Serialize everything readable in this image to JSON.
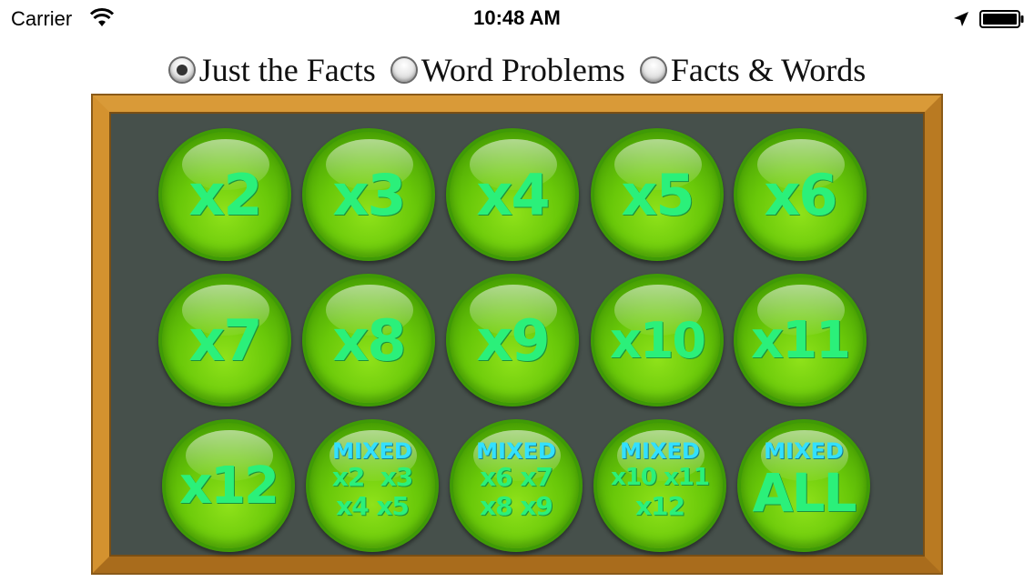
{
  "status_bar": {
    "carrier": "Carrier",
    "time": "10:48 AM",
    "icons": [
      "wifi-icon",
      "location-arrow-icon",
      "battery-icon"
    ]
  },
  "modes": [
    {
      "label": "Just the Facts",
      "selected": true
    },
    {
      "label": "Word Problems",
      "selected": false
    },
    {
      "label": "Facts & Words",
      "selected": false
    }
  ],
  "buttons": {
    "x2": "x2",
    "x3": "x3",
    "x4": "x4",
    "x5": "x5",
    "x6": "x6",
    "x7": "x7",
    "x8": "x8",
    "x9": "x9",
    "x10": "x10",
    "x11": "x11",
    "x12": "x12",
    "mixed_a": {
      "title": "MIXED",
      "line1": "x2  x3",
      "line2": "x4 x5"
    },
    "mixed_b": {
      "title": "MIXED",
      "line1": "x6 x7",
      "line2": "x8 x9"
    },
    "mixed_c": {
      "title": "MIXED",
      "line1": "x10 x11",
      "line2": "x12"
    },
    "mixed_all": {
      "title": "MIXED",
      "line1": "ALL"
    }
  },
  "colors": {
    "board": "#46504b",
    "frame": "#c98a2c",
    "button_green": "#69c809",
    "label_green": "#2bf07a",
    "label_cyan": "#33e0ff"
  }
}
